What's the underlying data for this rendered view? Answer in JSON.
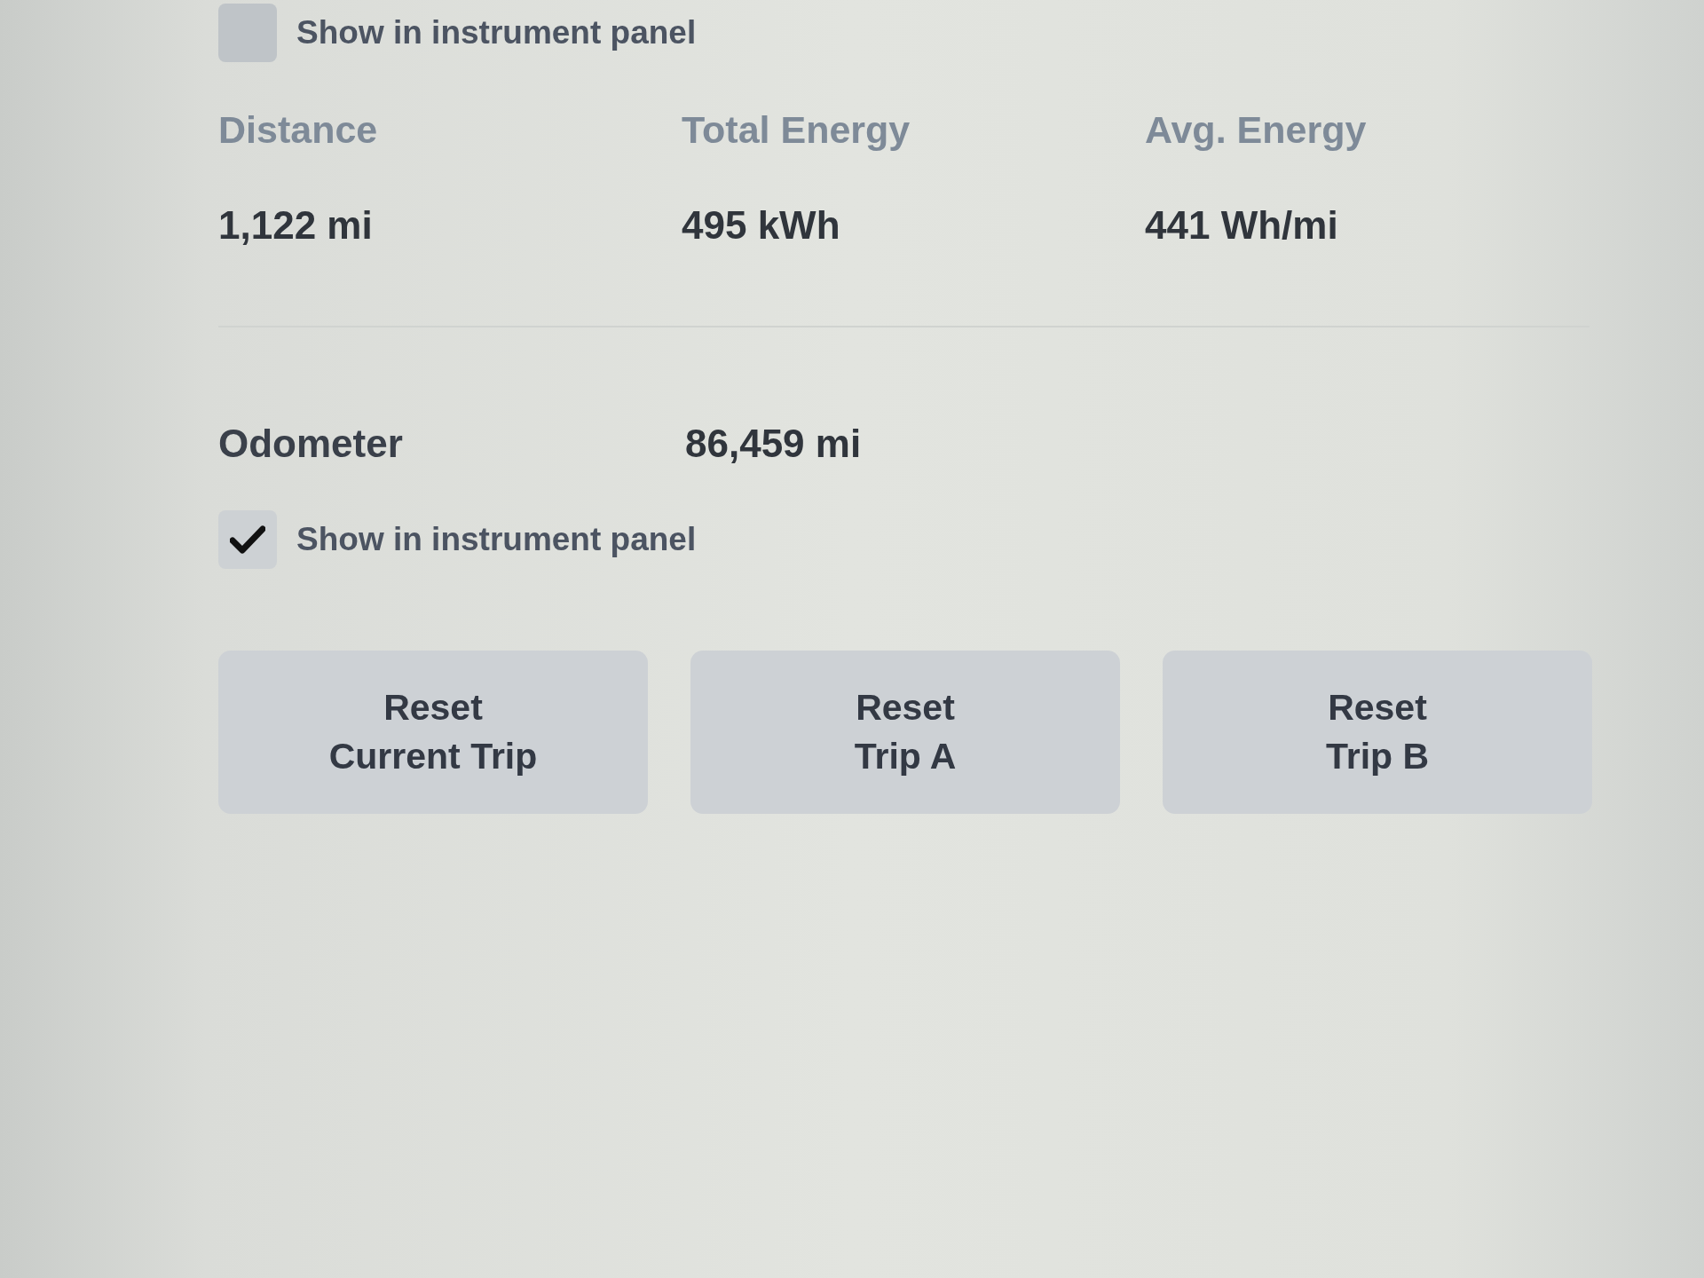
{
  "trip": {
    "show_in_instrument_panel": {
      "label": "Show in instrument panel",
      "checked": false
    },
    "stats": [
      {
        "heading": "Distance",
        "value": "1,122 mi"
      },
      {
        "heading": "Total Energy",
        "value": "495 kWh"
      },
      {
        "heading": "Avg. Energy",
        "value": "441 Wh/mi"
      }
    ]
  },
  "odometer": {
    "label": "Odometer",
    "value": "86,459 mi",
    "show_in_instrument_panel": {
      "label": "Show in instrument panel",
      "checked": true
    }
  },
  "buttons": [
    {
      "label": "Reset\nCurrent Trip"
    },
    {
      "label": "Reset\nTrip A"
    },
    {
      "label": "Reset\nTrip B"
    }
  ]
}
